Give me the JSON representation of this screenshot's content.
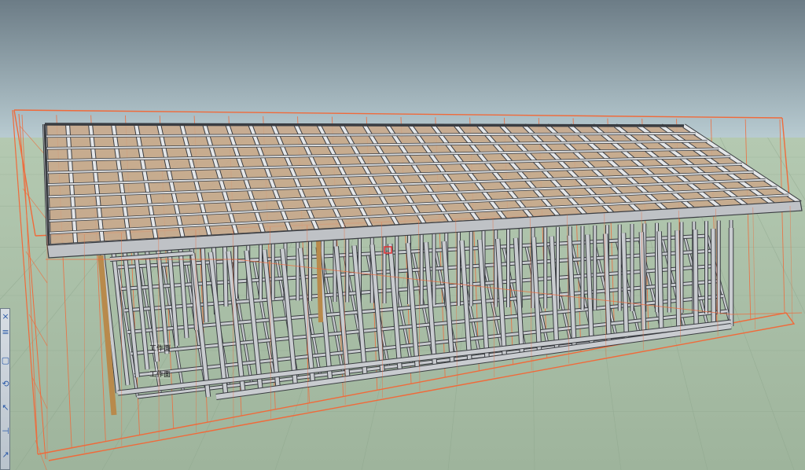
{
  "viewport": {
    "labels": [
      "工作面",
      "工作面"
    ],
    "colors": {
      "sky_top": "#6e7f89",
      "sky_bottom": "#b9ccd2",
      "ground": "#a9c0a6",
      "frame_edge": "#f06a3a",
      "steel": "#c9ccd0",
      "steel_dark": "#3a3d42",
      "board": "#c9a98c",
      "timber": "#b88a4c"
    }
  },
  "toolbar": {
    "tools": [
      {
        "icon": "close-icon",
        "glyph": "×"
      },
      {
        "icon": "menu-icon",
        "glyph": "≡"
      },
      {
        "icon": "select-box-icon",
        "glyph": "▢"
      },
      {
        "icon": "orbit-icon",
        "glyph": "⟲"
      },
      {
        "icon": "cursor-icon",
        "glyph": "↖"
      },
      {
        "icon": "measure-icon",
        "glyph": "⊣"
      },
      {
        "icon": "pan-icon",
        "glyph": "↗"
      }
    ]
  }
}
